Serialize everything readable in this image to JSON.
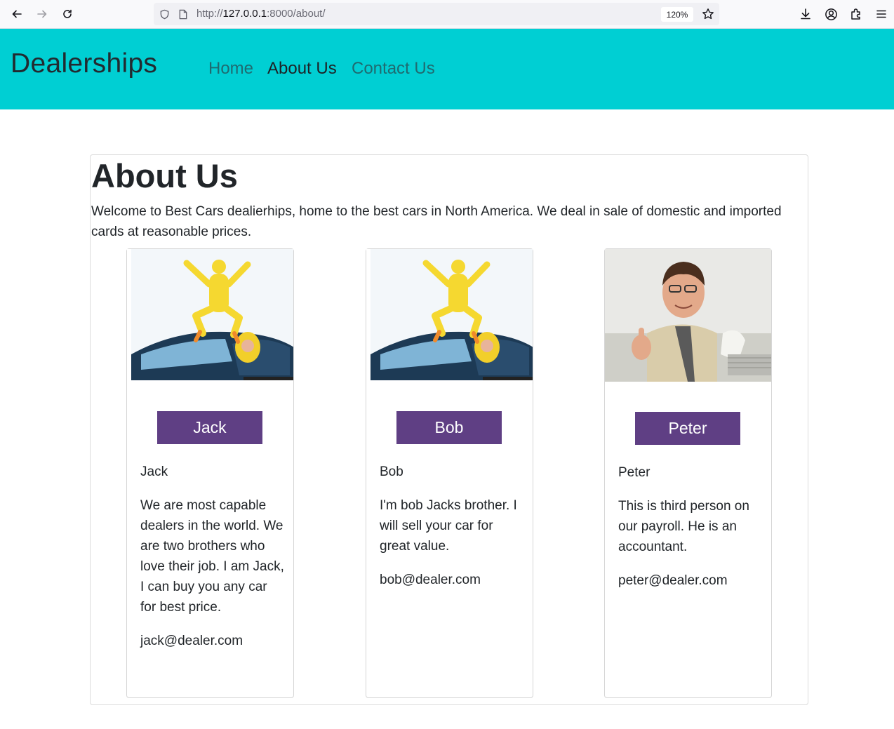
{
  "browser": {
    "url_prefix": "http://",
    "url_host": "127.0.0.1",
    "url_rest": ":8000/about/",
    "zoom": "120%"
  },
  "navbar": {
    "brand": "Dealerships",
    "links": [
      {
        "label": "Home",
        "active": false
      },
      {
        "label": "About Us",
        "active": true
      },
      {
        "label": "Contact Us",
        "active": false
      }
    ]
  },
  "about": {
    "title": "About Us",
    "intro": "Welcome to Best Cars dealierhips, home to the best cars in North America. We deal in sale of domestic and imported cards at reasonable prices."
  },
  "people": [
    {
      "button": "Jack",
      "name": "Jack",
      "description": "We are most capable dealers in the world. We are two brothers who love their job. I am Jack, I can buy you any car for best price.",
      "email": "jack@dealer.com",
      "photo": "chicken-costume-car-photo"
    },
    {
      "button": "Bob",
      "name": "Bob",
      "description": "I'm bob Jacks brother. I will sell your car for great value.",
      "email": "bob@dealer.com",
      "photo": "chicken-costume-car-photo"
    },
    {
      "button": "Peter",
      "name": "Peter",
      "description": "This is third person on our payroll. He is an accountant.",
      "email": "peter@dealer.com",
      "photo": "accountant-thumbs-up-photo"
    }
  ],
  "colors": {
    "navbar_bg": "#00cfd3",
    "button_bg": "#5f3f84"
  }
}
